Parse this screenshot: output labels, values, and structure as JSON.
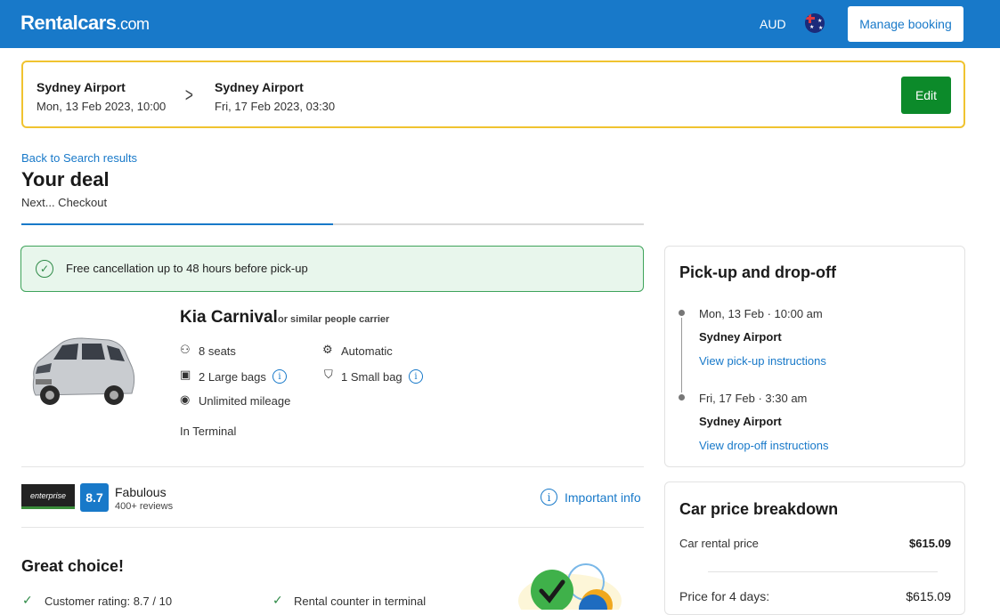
{
  "header": {
    "logo_main": "Rentalcars",
    "logo_suffix": ".com",
    "currency": "AUD",
    "flag_icon": "australia-flag-icon",
    "manage_booking": "Manage booking"
  },
  "search": {
    "pickup_location": "Sydney Airport",
    "pickup_datetime": "Mon, 13 Feb 2023, 10:00",
    "dropoff_location": "Sydney Airport",
    "dropoff_datetime": "Fri, 17 Feb 2023, 03:30",
    "edit_label": "Edit"
  },
  "page": {
    "back_link": "Back to Search results",
    "title": "Your deal",
    "next_step": "Next... Checkout",
    "progress_fraction": 0.5
  },
  "cancellation": {
    "text": "Free cancellation up to 48 hours before pick-up"
  },
  "car": {
    "name": "Kia Carnival",
    "similar": "or similar people carrier",
    "specs": {
      "seats": "8 seats",
      "transmission": "Automatic",
      "large_bags": "2 Large bags",
      "small_bag": "1 Small bag",
      "mileage": "Unlimited mileage"
    },
    "location_type": "In Terminal"
  },
  "supplier": {
    "logo_text": "enterprise",
    "rating_score": "8.7",
    "rating_word": "Fabulous",
    "reviews": "400+ reviews",
    "important_info": "Important info"
  },
  "highlights": {
    "title": "Great choice!",
    "items": [
      "Customer rating: 8.7 / 10",
      "Rental counter in terminal"
    ]
  },
  "pickup_dropoff": {
    "title": "Pick-up and drop-off",
    "pickup_date": "Mon, 13 Feb · 10:00 am",
    "pickup_location": "Sydney Airport",
    "pickup_link": "View pick-up instructions",
    "dropoff_date": "Fri, 17 Feb · 3:30 am",
    "dropoff_location": "Sydney Airport",
    "dropoff_link": "View drop-off instructions"
  },
  "price_breakdown": {
    "title": "Car price breakdown",
    "rental_label": "Car rental price",
    "rental_value": "$615.09",
    "days_label": "Price for 4 days:",
    "days_value": "$615.09"
  },
  "colors": {
    "brand_blue": "#1879c9",
    "success_green": "#0c8a2a",
    "highlight_yellow": "#f0c330"
  }
}
